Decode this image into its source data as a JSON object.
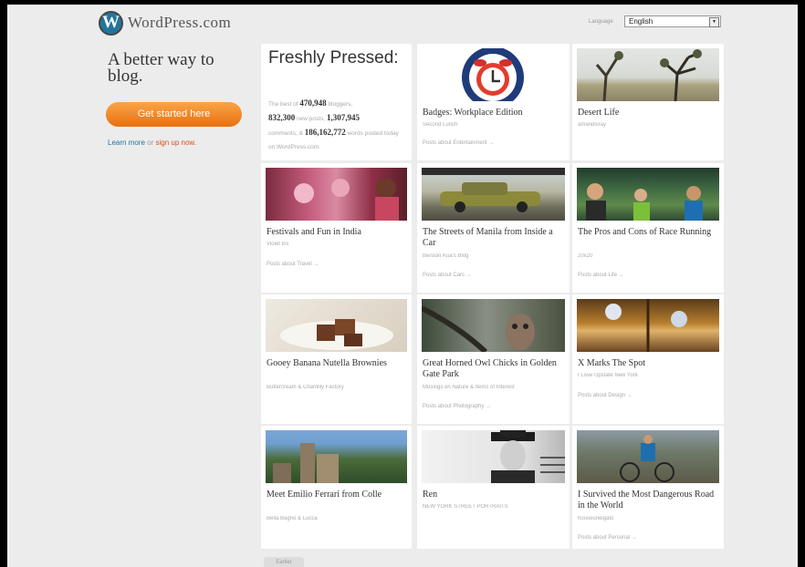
{
  "header": {
    "logo_text": "WordPress.com",
    "logo_mark": "W",
    "language_label": "Language",
    "language_value": "English"
  },
  "left": {
    "tagline": "A better way to blog.",
    "cta_label": "Get started here",
    "learn_more": "Learn more",
    "or": "or",
    "sign_up": "sign up now."
  },
  "freshly": {
    "title": "Freshly Pressed:",
    "t1": "The best of",
    "bloggers_count": "470,948",
    "t2": "bloggers,",
    "posts_count": "832,300",
    "t3": "new posts,",
    "comments_count": "1,307,945",
    "t4": "comments, &",
    "words_count": "186,162,772",
    "t5": "words posted today on WordPress.com."
  },
  "posts": [
    {
      "title": "Badges: Workplace Edition",
      "author": "Second Lunch",
      "topic": "Posts about Entertainment →"
    },
    {
      "title": "Desert Life",
      "author": "amandisray",
      "topic": ""
    },
    {
      "title": "Festivals and Fun in India",
      "author": "Violet Inc",
      "topic": "Posts about Travel →"
    },
    {
      "title": "The Streets of Manila from Inside a Car",
      "author": "Benson Kua's Blog",
      "topic": "Posts about Cars →"
    },
    {
      "title": "The Pros and Cons of Race Running",
      "author": "20x20",
      "topic": "Posts about Life →"
    },
    {
      "title": "Gooey Banana Nutella Brownies",
      "author": "Buttercream & Chantilly Factory",
      "topic": ""
    },
    {
      "title": "Great Horned Owl Chicks in Golden Gate Park",
      "author": "Musings on Nature & Items of Interest",
      "topic": "Posts about Photography →"
    },
    {
      "title": "X Marks The Spot",
      "author": "I Love Upstate New York",
      "topic": "Posts about Design →"
    },
    {
      "title": "Meet Emilio Ferrari from Colle",
      "author": "Bella Bagno & Lucca",
      "topic": ""
    },
    {
      "title": "Ren",
      "author": "NEW YORK STREET PORTRAITS",
      "topic": ""
    },
    {
      "title": "I Survived the Most Dangerous Road in the World",
      "author": "houseuneigato",
      "topic": "Posts about Personal →"
    }
  ],
  "pagination": {
    "earlier": "Earlier"
  },
  "colors": {
    "accent": "#21759b",
    "orange": "#f08a24",
    "signup": "#d54e21"
  }
}
